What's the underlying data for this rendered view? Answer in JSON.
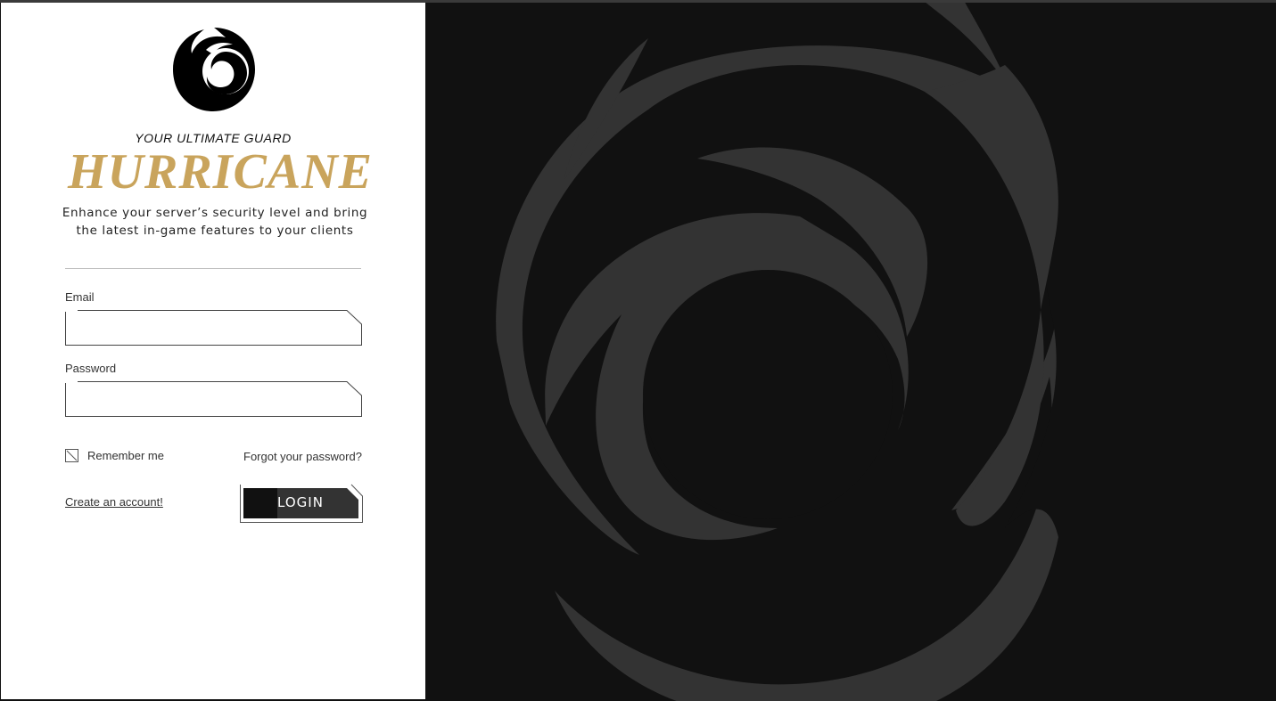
{
  "brand": {
    "tagline": "YOUR ULTIMATE GUARD",
    "name": "HURRICANE",
    "description_line1": "Enhance your server’s security level and bring",
    "description_line2": "the latest in-game features to your clients",
    "logo_icon": "hurricane-swirl-logo",
    "accent_color": "#c9a45c"
  },
  "form": {
    "email_label": "Email",
    "email_value": "",
    "password_label": "Password",
    "password_value": "",
    "remember_label": "Remember me",
    "remember_checked": false,
    "forgot_link": "Forgot your password?",
    "create_link": "Create an account!",
    "login_button": "LOGIN"
  },
  "background": {
    "icon": "hurricane-swirl-graphic",
    "panel_color": "#111111",
    "swirl_color": "#333333"
  }
}
